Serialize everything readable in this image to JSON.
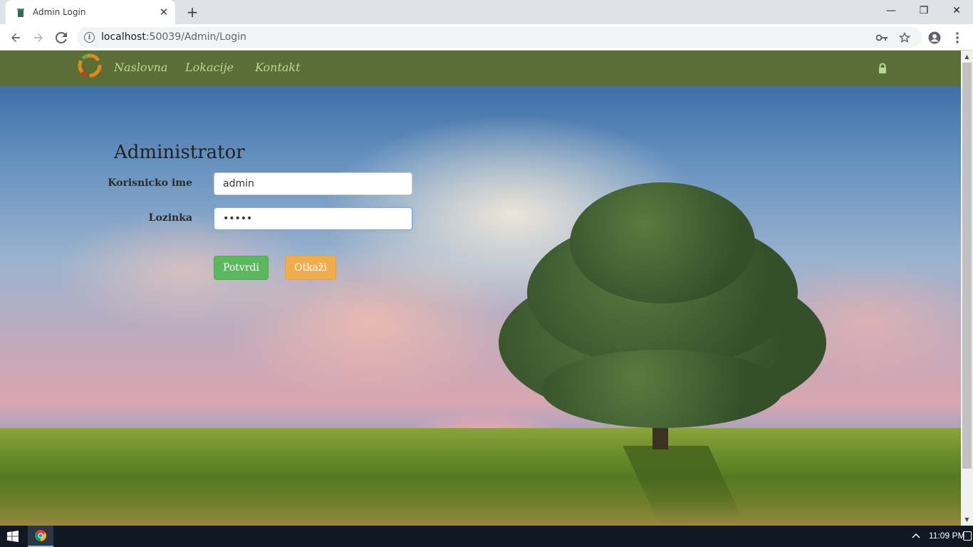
{
  "browser": {
    "tab_title": "Admin Login",
    "tab_close": "✕",
    "new_tab": "+",
    "url_host": "localhost",
    "url_rest": ":50039/Admin/Login",
    "window_controls": {
      "minimize": "—",
      "restore": "❐",
      "close": "✕"
    }
  },
  "site": {
    "nav": {
      "home": "Naslovna",
      "locations": "Lokacije",
      "contact": "Kontakt"
    }
  },
  "login": {
    "title": "Administrator",
    "username_label": "Korisnicko ime",
    "username_value": "admin",
    "password_label": "Lozinka",
    "password_value": "•••••",
    "confirm_label": "Potvrdi",
    "cancel_label": "Otkaži"
  },
  "taskbar": {
    "clock": "11:09 PM"
  },
  "colors": {
    "nav_bg": "#5a6e35",
    "nav_link": "#b9d99a",
    "confirm": "#5cb85c",
    "cancel": "#f0ad4e"
  },
  "icons": [
    "app-favicon-icon",
    "back-icon",
    "forward-icon",
    "reload-icon",
    "info-icon",
    "key-icon",
    "star-icon",
    "account-icon",
    "menu-icon",
    "site-logo-icon",
    "lock-icon",
    "windows-start-icon",
    "chrome-icon",
    "tray-arrow-icon",
    "notification-icon"
  ]
}
